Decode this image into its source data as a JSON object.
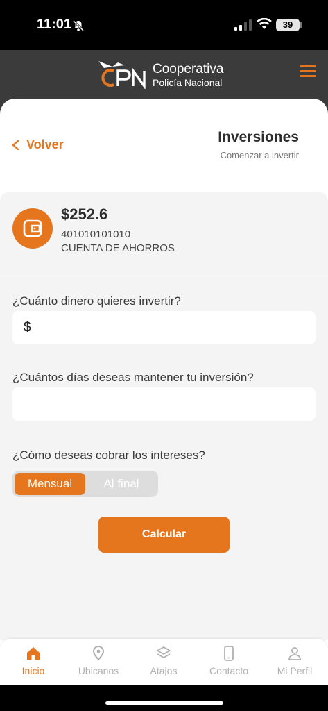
{
  "status_bar": {
    "time": "11:01",
    "battery": "39"
  },
  "header": {
    "brand_line1": "Cooperativa",
    "brand_line2": "Policía Nacional",
    "logo_text": "CPN"
  },
  "nav_top": {
    "back_label": "Volver",
    "title": "Inversiones",
    "subtitle": "Comenzar a invertir"
  },
  "account": {
    "balance": "$252.6",
    "number": "401010101010",
    "type": "CUENTA DE AHORROS"
  },
  "form": {
    "amount_question": "¿Cuánto dinero quieres invertir?",
    "amount_prefix": "$",
    "amount_value": "",
    "days_question": "¿Cuántos días deseas mantener tu inversión?",
    "days_value": "",
    "interest_question": "¿Cómo deseas cobrar los intereses?",
    "interest_options": [
      "Mensual",
      "Al final"
    ],
    "interest_selected": "Mensual",
    "calculate_label": "Calcular"
  },
  "bottom_nav": {
    "items": [
      {
        "label": "Inicio",
        "icon": "home-icon",
        "active": true
      },
      {
        "label": "Ubicanos",
        "icon": "location-pin-icon",
        "active": false
      },
      {
        "label": "Atajos",
        "icon": "layers-icon",
        "active": false
      },
      {
        "label": "Contacto",
        "icon": "phone-icon",
        "active": false
      },
      {
        "label": "Mi Perfil",
        "icon": "user-icon",
        "active": false
      }
    ]
  },
  "colors": {
    "accent": "#e5761e",
    "header_bg": "#3b3b3b",
    "form_bg": "#f4f4f4"
  }
}
